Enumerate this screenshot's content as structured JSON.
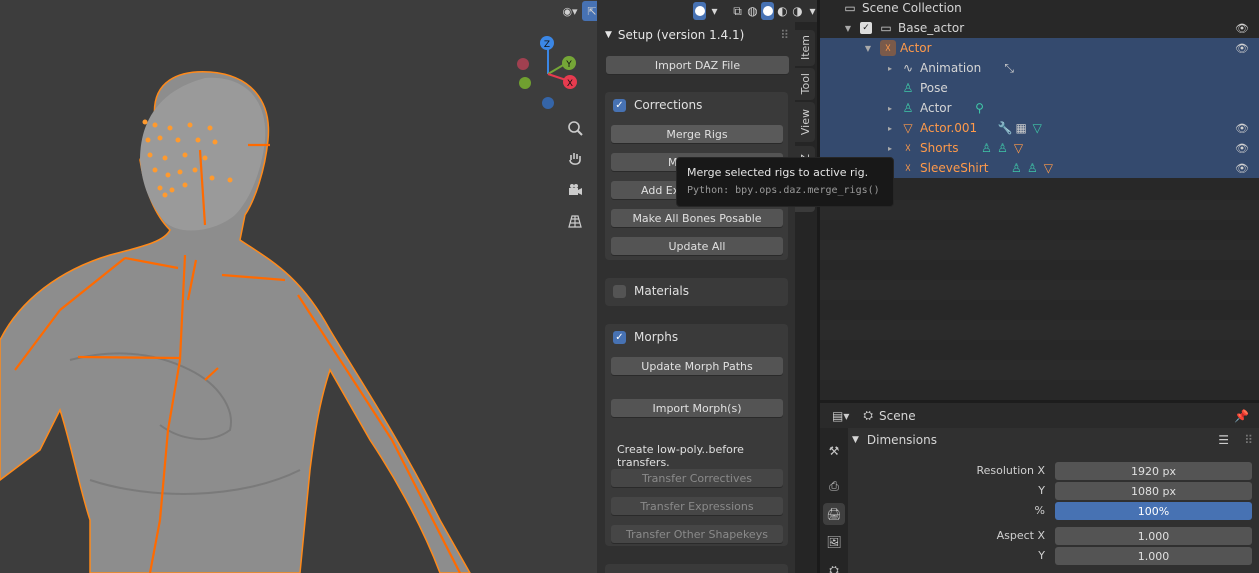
{
  "viewport": {
    "gizmo_axes": {
      "z": "Z",
      "y": "Y",
      "x": "X"
    },
    "colors": {
      "x": "#e63b4f",
      "y": "#75a637",
      "z": "#3b87e6",
      "rig": "#ff6a00",
      "outline": "#ff8a1a"
    }
  },
  "npanel": {
    "title": "Setup (version 1.4.1)",
    "import_button": "Import DAZ File",
    "corrections": {
      "label": "Corrections",
      "checked": true,
      "buttons": [
        "Merge Rigs",
        "Merge Toes",
        "Add Extra Face Bones",
        "Make All Bones Posable",
        "Update All"
      ],
      "partial_labels": [
        "Me",
        "Add Ex"
      ]
    },
    "materials": {
      "label": "Materials",
      "checked": false
    },
    "morphs": {
      "label": "Morphs",
      "checked": true,
      "update_button": "Update Morph Paths",
      "import_button": "Import Morph(s)",
      "note": "Create low-poly..before transfers.",
      "transfer_buttons": [
        "Transfer Correctives",
        "Transfer Expressions",
        "Transfer Other Shapekeys"
      ]
    }
  },
  "tabs": [
    "Item",
    "Tool",
    "View",
    "Z"
  ],
  "tooltip": {
    "text": "Merge selected rigs to active rig.",
    "python": "Python: bpy.ops.daz.merge_rigs()"
  },
  "outliner": {
    "rows": [
      {
        "name": "Scene Collection"
      },
      {
        "name": "Base_actor"
      },
      {
        "name": "Actor"
      },
      {
        "name": "Animation"
      },
      {
        "name": "Pose"
      },
      {
        "name": "Actor"
      },
      {
        "name": "Actor.001"
      },
      {
        "name": "Shorts"
      },
      {
        "name": "SleeveShirt"
      }
    ]
  },
  "properties": {
    "context": "Scene",
    "panel": "Dimensions",
    "fields": [
      {
        "label": "Resolution X",
        "value": "1920 px"
      },
      {
        "label": "Y",
        "value": "1080 px"
      },
      {
        "label": "%",
        "value": "100%"
      },
      {
        "label": "Aspect X",
        "value": "1.000"
      },
      {
        "label": "Y",
        "value": "1.000"
      }
    ]
  }
}
